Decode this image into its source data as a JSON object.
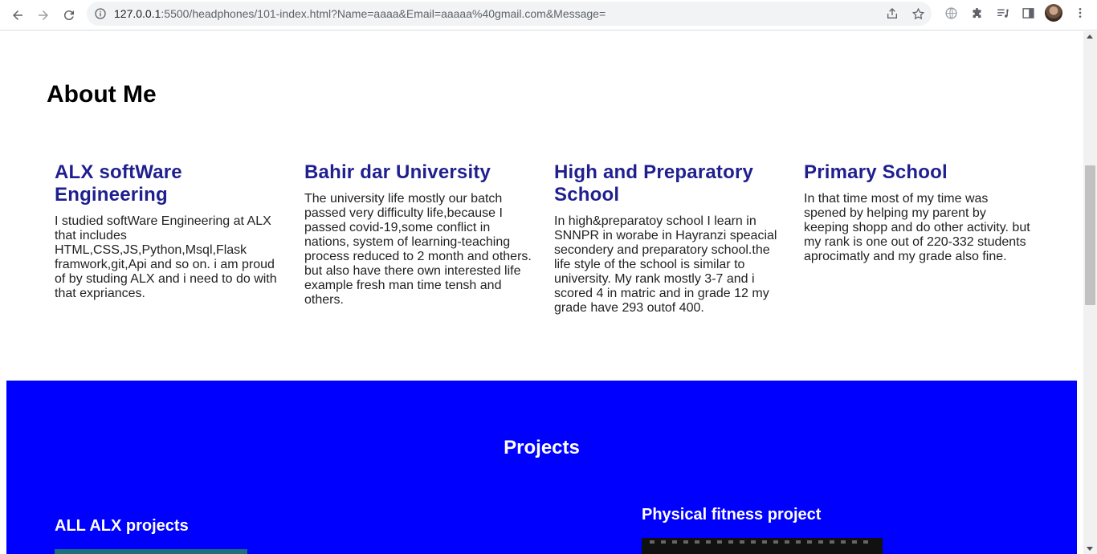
{
  "browser": {
    "url_host": "127.0.0.1",
    "url_path": ":5500/headphones/101-index.html?Name=aaaa&Email=aaaaa%40gmail.com&Message="
  },
  "about": {
    "title": "About Me",
    "cards": [
      {
        "heading": "ALX softWare Engineering",
        "body": "I studied softWare Engineering at ALX that includes HTML,CSS,JS,Python,Msql,Flask framwork,git,Api and so on. i am proud of by studing ALX and i need to do with that expriances."
      },
      {
        "heading": "Bahir dar University",
        "body": "The university life mostly our batch passed very difficulty life,because I passed covid-19,some conflict in nations, system of learning-teaching process reduced to 2 month and others. but also have there own interested life example fresh man time tensh and others."
      },
      {
        "heading": "High and Preparatory School",
        "body": "In high&preparatoy school I learn in SNNPR in worabe in Hayranzi speacial secondery and preparatory school.the life style of the school is similar to university. My rank mostly 3-7 and i scored 4 in matric and in grade 12 my grade have 293 outof 400."
      },
      {
        "heading": "Primary School",
        "body": "In that time most of my time was spened by helping my parent by keeping shopp and do other activity. but my rank is one out of 220-332 students aprocimatly and my grade also fine."
      }
    ]
  },
  "projects": {
    "title": "Projects",
    "items": [
      {
        "title": "ALL ALX projects"
      },
      {
        "title": "Physical fitness project"
      }
    ]
  },
  "colors": {
    "projects_bg": "#0000ff",
    "card_heading": "#1f1f8f"
  }
}
